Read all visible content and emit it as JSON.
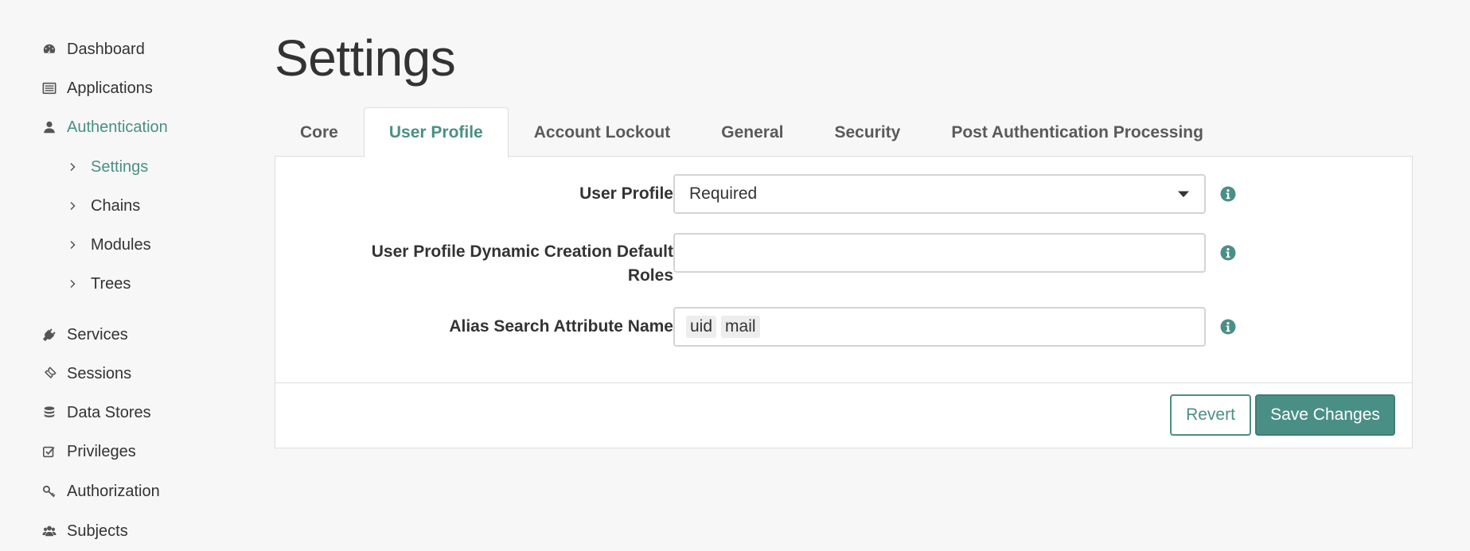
{
  "sidebar": {
    "items": [
      {
        "label": "Dashboard",
        "icon": "dashboard-icon"
      },
      {
        "label": "Applications",
        "icon": "applications-icon"
      },
      {
        "label": "Authentication",
        "icon": "user-icon",
        "active": true,
        "children": [
          {
            "label": "Settings",
            "active": true
          },
          {
            "label": "Chains"
          },
          {
            "label": "Modules"
          },
          {
            "label": "Trees"
          }
        ]
      },
      {
        "label": "Services",
        "icon": "plug-icon"
      },
      {
        "label": "Sessions",
        "icon": "ticket-icon"
      },
      {
        "label": "Data Stores",
        "icon": "database-icon"
      },
      {
        "label": "Privileges",
        "icon": "checkbox-icon"
      },
      {
        "label": "Authorization",
        "icon": "key-icon"
      },
      {
        "label": "Subjects",
        "icon": "users-icon"
      }
    ]
  },
  "page": {
    "title": "Settings"
  },
  "tabs": [
    {
      "label": "Core"
    },
    {
      "label": "User Profile",
      "active": true
    },
    {
      "label": "Account Lockout"
    },
    {
      "label": "General"
    },
    {
      "label": "Security"
    },
    {
      "label": "Post Authentication Processing"
    }
  ],
  "form": {
    "user_profile": {
      "label": "User Profile",
      "value": "Required"
    },
    "dynamic_roles": {
      "label_line1": "User Profile Dynamic Creation Default",
      "label_line2": "Roles",
      "value": ""
    },
    "alias_search": {
      "label": "Alias Search Attribute Name",
      "tags": [
        "uid",
        "mail"
      ]
    }
  },
  "footer": {
    "revert_label": "Revert",
    "save_label": "Save Changes"
  },
  "colors": {
    "accent": "#4a8f85",
    "background": "#f7f7f7",
    "text": "#333333"
  }
}
